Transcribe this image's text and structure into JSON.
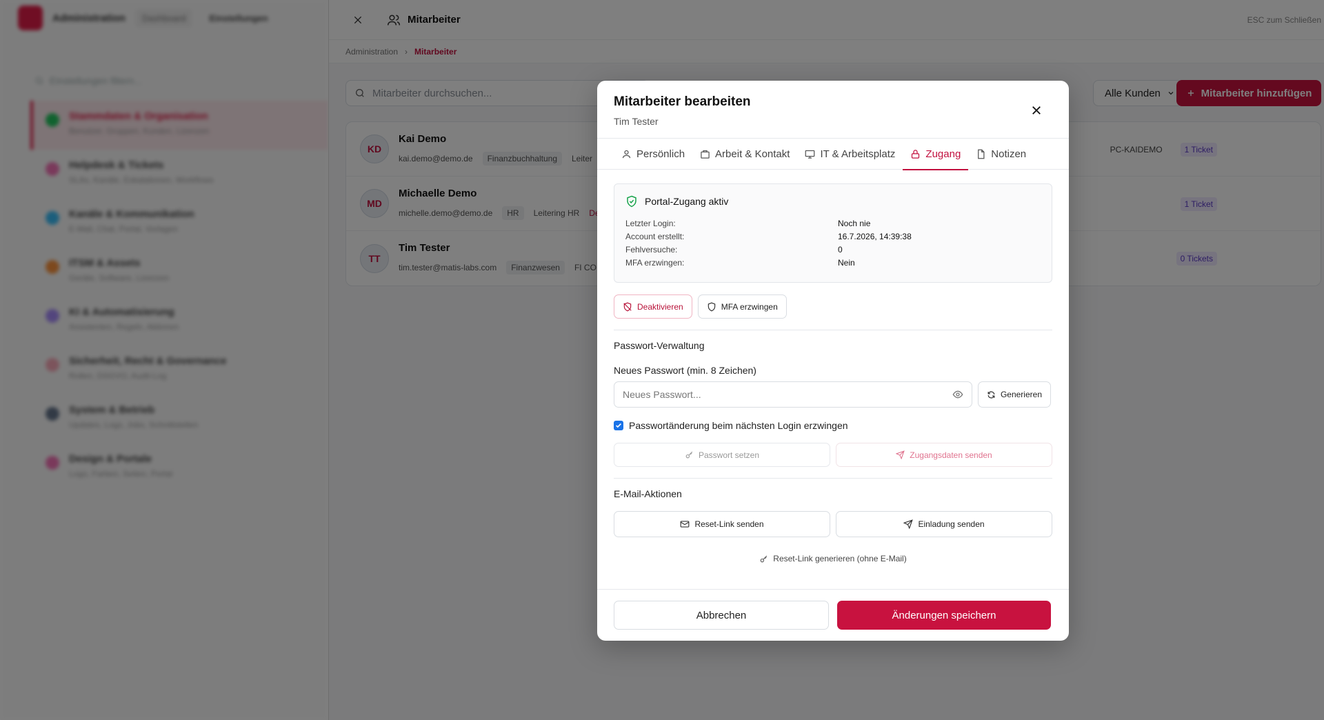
{
  "colors": {
    "accent": "#c8123f",
    "checkbox": "#1a73e8",
    "ticket": "#5b3ac7",
    "ok": "#16a34a"
  },
  "bg": {
    "app_name": "Administration",
    "top_tabs": [
      "Dashboard",
      "Einstellungen"
    ],
    "search_placeholder": "Einstellungen filtern...",
    "items": [
      {
        "title": "Stammdaten & Organisation",
        "sub": "Benutzer, Gruppen, Kunden, Lizenzen",
        "color": "#22c55e"
      },
      {
        "title": "Helpdesk & Tickets",
        "sub": "SLAs, Kanäle, Eskalationen, Workflows",
        "color": "#f472b6"
      },
      {
        "title": "Kanäle & Kommunikation",
        "sub": "E-Mail, Chat, Portal, Vorlagen",
        "color": "#38bdf8"
      },
      {
        "title": "ITSM & Assets",
        "sub": "Geräte, Software, Lizenzen",
        "color": "#fb923c"
      },
      {
        "title": "KI & Automatisierung",
        "sub": "Assistenten, Regeln, Aktionen",
        "color": "#a78bfa"
      },
      {
        "title": "Sicherheit, Recht & Governance",
        "sub": "Rollen, DSGVO, Audit-Log",
        "color": "#f9a8b8"
      },
      {
        "title": "System & Betrieb",
        "sub": "Updates, Logs, Jobs, Schnittstellen",
        "color": "#64748b"
      },
      {
        "title": "Design & Portale",
        "sub": "Logo, Farben, Seiten, Portal",
        "color": "#f472b6"
      }
    ]
  },
  "panel": {
    "title": "Mitarbeiter",
    "esc_hint": "ESC zum Schließen",
    "breadcrumb": {
      "parent": "Administration",
      "current": "Mitarbeiter"
    },
    "search_placeholder": "Mitarbeiter durchsuchen...",
    "customer_filter": "Alle Kunden",
    "add_button": "Mitarbeiter hinzufügen",
    "employees": [
      {
        "initials": "KD",
        "name": "Kai Demo",
        "email": "kai.demo@demo.de",
        "dept": "Finanzbuchhaltung",
        "role": "Leiter",
        "device": "PC-KAIDEMO",
        "tickets": "1 Ticket"
      },
      {
        "initials": "MD",
        "name": "Michaelle Demo",
        "email": "michelle.demo@demo.de",
        "dept": "HR",
        "role": "Leitering HR",
        "extra": "De",
        "tickets": "1 Ticket"
      },
      {
        "initials": "TT",
        "name": "Tim Tester",
        "email": "tim.tester@matis-labs.com",
        "dept": "Finanzwesen",
        "role": "FI CO",
        "tickets": "0 Tickets"
      }
    ]
  },
  "modal": {
    "title": "Mitarbeiter bearbeiten",
    "subtitle": "Tim Tester",
    "tabs": [
      "Persönlich",
      "Arbeit & Kontakt",
      "IT & Arbeitsplatz",
      "Zugang",
      "Notizen"
    ],
    "status": {
      "title": "Portal-Zugang aktiv",
      "rows": [
        {
          "k": "Letzter Login:",
          "v": "Noch nie"
        },
        {
          "k": "Account erstellt:",
          "v": "16.7.2026, 14:39:38"
        },
        {
          "k": "Fehlversuche:",
          "v": "0"
        },
        {
          "k": "MFA erzwingen:",
          "v": "Nein"
        }
      ]
    },
    "deactivate_label": "Deaktivieren",
    "mfa_label": "MFA erzwingen",
    "password_section": "Passwort-Verwaltung",
    "password_label": "Neues Passwort (min. 8 Zeichen)",
    "password_placeholder": "Neues Passwort...",
    "generate_label": "Generieren",
    "force_change_label": "Passwortänderung beim nächsten Login erzwingen",
    "set_password_label": "Passwort setzen",
    "send_credentials_label": "Zugangsdaten senden",
    "email_section": "E-Mail-Aktionen",
    "reset_link_label": "Reset-Link senden",
    "invite_label": "Einladung senden",
    "reset_generate_label": "Reset-Link generieren (ohne E-Mail)",
    "cancel_label": "Abbrechen",
    "save_label": "Änderungen speichern"
  }
}
